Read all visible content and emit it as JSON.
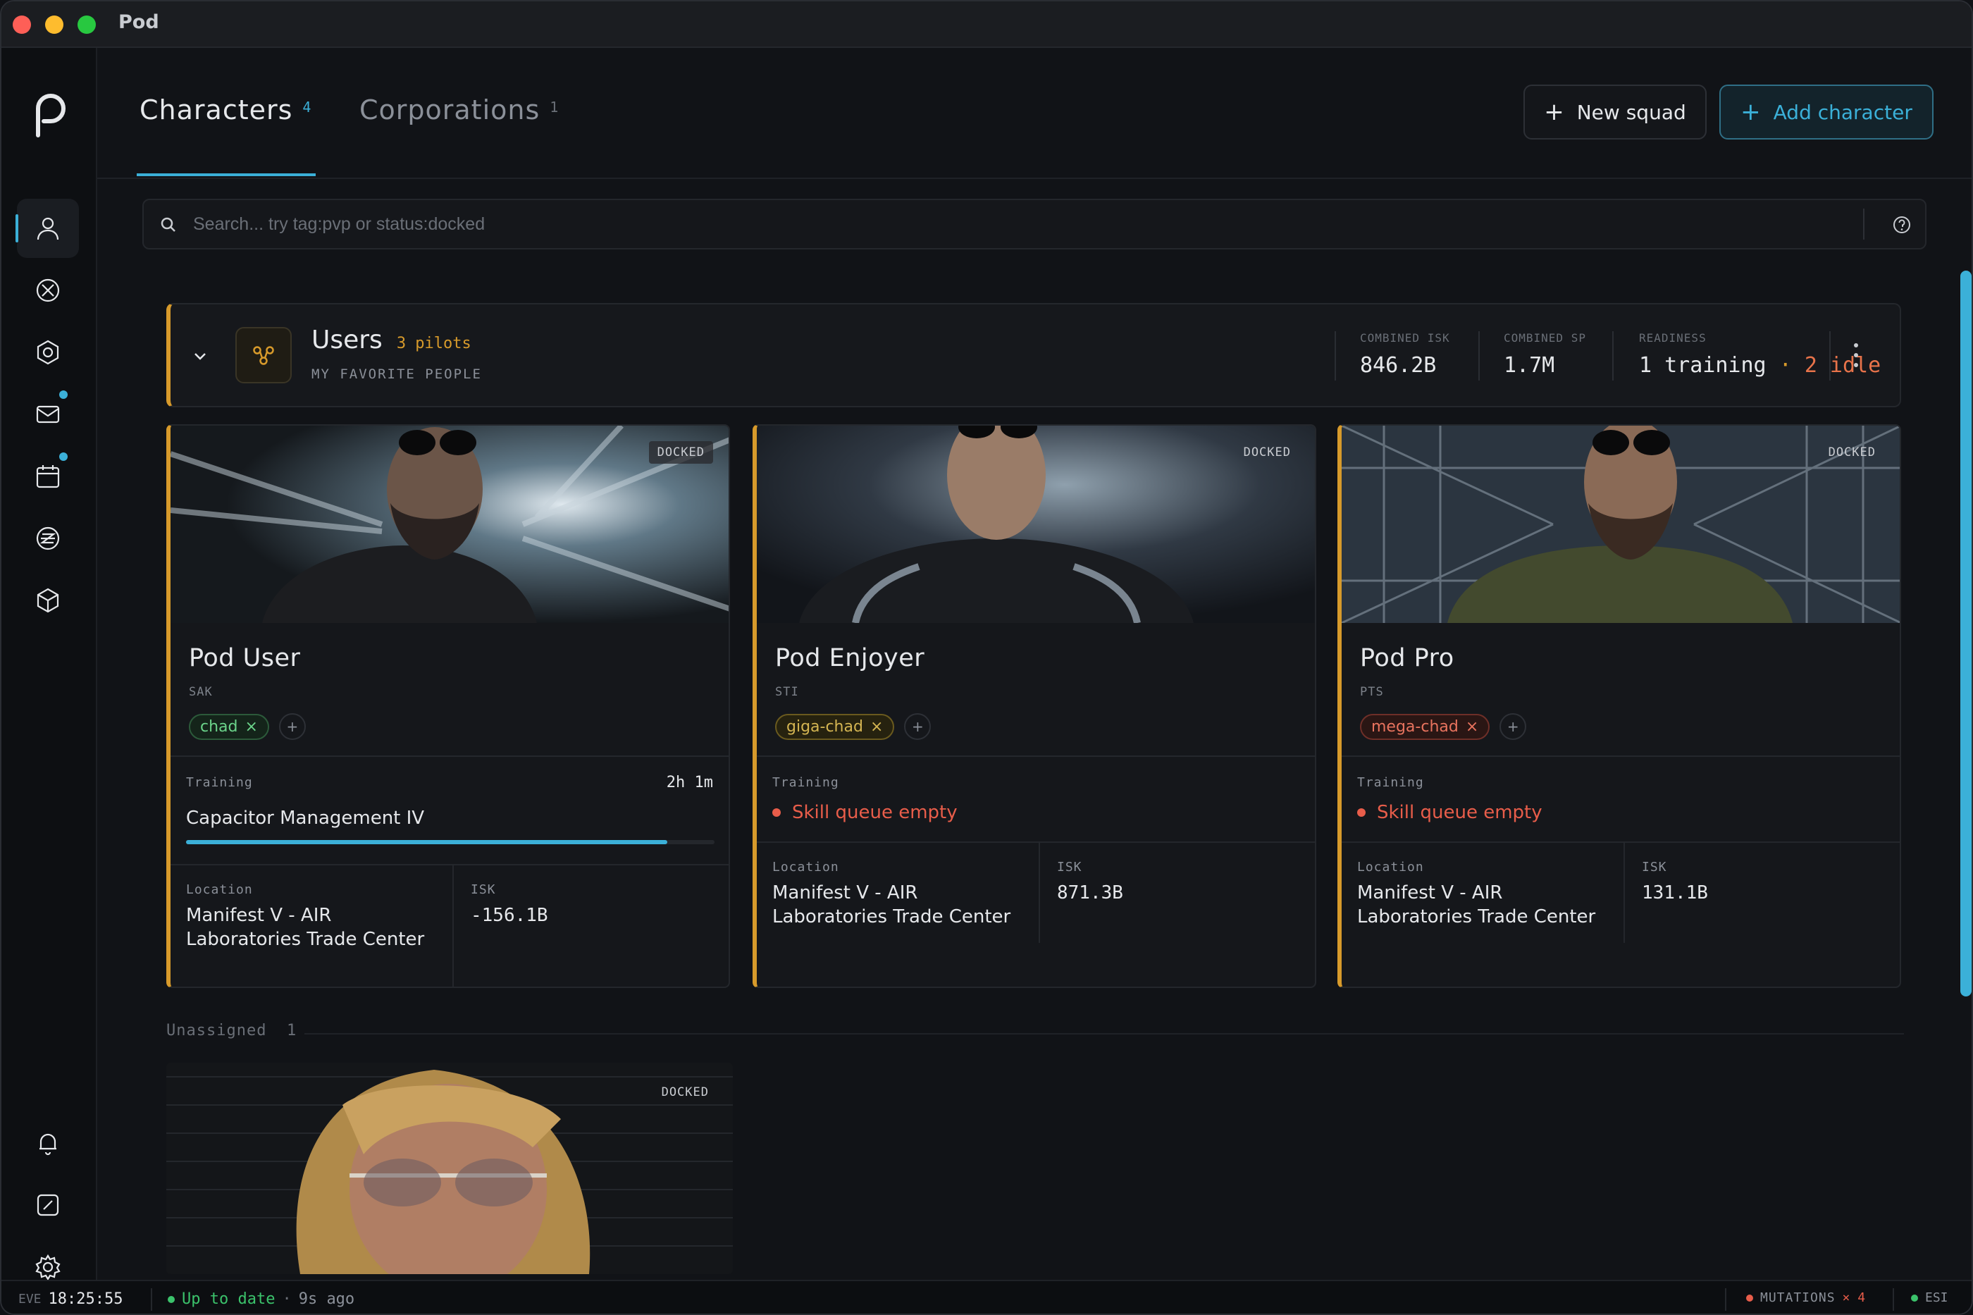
{
  "window": {
    "title": "Pod"
  },
  "tabs": [
    {
      "label": "Characters",
      "count": "4"
    },
    {
      "label": "Corporations",
      "count": "1"
    }
  ],
  "actions": {
    "new_squad": "New squad",
    "add_character": "Add character"
  },
  "search": {
    "placeholder": "Search... try tag:pvp or status:docked"
  },
  "group": {
    "name": "Users",
    "pilots": "3 pilots",
    "subtitle": "MY FAVORITE PEOPLE",
    "stats": [
      {
        "label": "COMBINED ISK",
        "value": "846.2B"
      },
      {
        "label": "COMBINED SP",
        "value": "1.7M"
      },
      {
        "label": "READINESS",
        "training": "1 training",
        "sep": "·",
        "idle": "2 idle"
      }
    ]
  },
  "characters": [
    {
      "name": "Pod User",
      "ticker": "SAK",
      "status": "DOCKED",
      "tag": "chad",
      "training_label": "Training",
      "training_time": "2h 1m",
      "skill": "Capacitor Management IV",
      "progress": 0.91,
      "location_label": "Location",
      "location": "Manifest V - AIR Laboratories Trade Center",
      "isk_label": "ISK",
      "isk": "-156.1B"
    },
    {
      "name": "Pod Enjoyer",
      "ticker": "STI",
      "status": "DOCKED",
      "tag": "giga-chad",
      "training_label": "Training",
      "training_status": "Skill queue empty",
      "location_label": "Location",
      "location": "Manifest V - AIR Laboratories Trade Center",
      "isk_label": "ISK",
      "isk": "871.3B"
    },
    {
      "name": "Pod Pro",
      "ticker": "PTS",
      "status": "DOCKED",
      "tag": "mega-chad",
      "training_label": "Training",
      "training_status": "Skill queue empty",
      "location_label": "Location",
      "location": "Manifest V - AIR Laboratories Trade Center",
      "isk_label": "ISK",
      "isk": "131.1B"
    }
  ],
  "unassigned": {
    "label": "Unassigned",
    "count": "1",
    "card_status": "DOCKED"
  },
  "statusbar": {
    "eve_label": "EVE",
    "time": "18:25:55",
    "sync": "Up to date",
    "sep": "·",
    "ago": "9s ago",
    "mutations_label": "MUTATIONS",
    "mutations": "× 4",
    "esi": "ESI"
  },
  "colors": {
    "accent": "#3bb0d8",
    "gold": "#d79a2b",
    "error": "#e85d4a",
    "ok": "#3bc26b"
  },
  "icons": [
    "pod-logo-icon",
    "characters-icon",
    "corporation-icon",
    "settings-hex-icon",
    "mail-icon",
    "calendar-icon",
    "zkill-icon",
    "cube-icon",
    "bell-icon",
    "chart-icon",
    "gear-icon"
  ]
}
